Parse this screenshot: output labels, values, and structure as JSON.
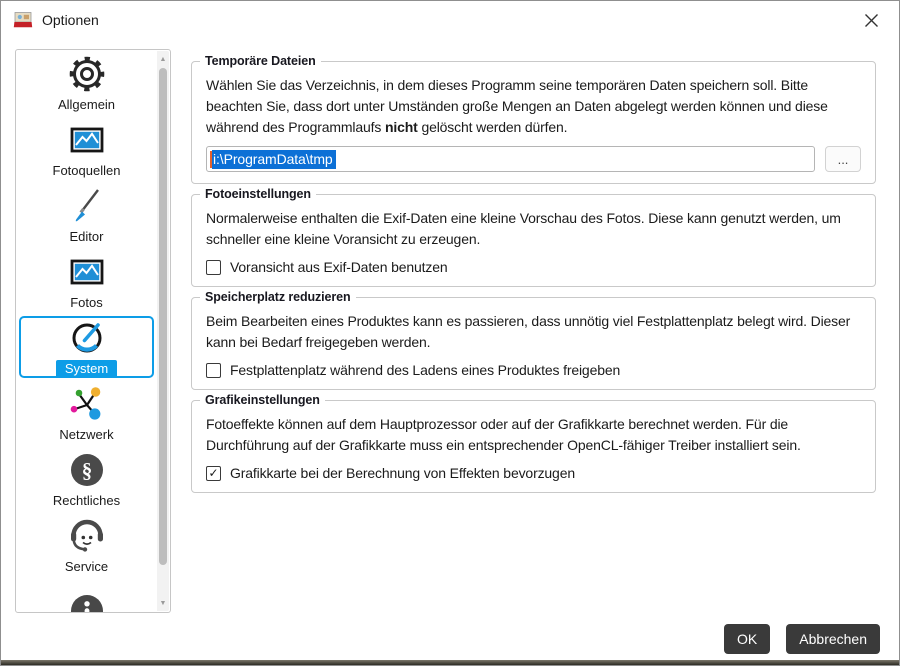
{
  "window": {
    "title": "Optionen"
  },
  "icons": {
    "checkmark": "✓",
    "scroll_up": "▲",
    "scroll_down": "▼"
  },
  "colors": {
    "accent": "#0d9de7",
    "selection": "#0c70d6",
    "button_dark": "#3a3a3a"
  },
  "sidebar": {
    "items": [
      {
        "label": "Allgemein",
        "icon": "gear",
        "selected": false
      },
      {
        "label": "Fotoquellen",
        "icon": "photo",
        "selected": false
      },
      {
        "label": "Editor",
        "icon": "brush",
        "selected": false
      },
      {
        "label": "Fotos",
        "icon": "photo",
        "selected": false
      },
      {
        "label": "System",
        "icon": "gauge",
        "selected": true
      },
      {
        "label": "Netzwerk",
        "icon": "network",
        "selected": false
      },
      {
        "label": "Rechtliches",
        "icon": "paragraph",
        "selected": false
      },
      {
        "label": "Service",
        "icon": "headset",
        "selected": false
      },
      {
        "label": "",
        "icon": "info",
        "selected": false
      }
    ]
  },
  "groups": [
    {
      "legend": "Temporäre Dateien",
      "desc_before": "Wählen Sie das Verzeichnis, in dem dieses Programm seine temporären Daten speichern soll. Bitte beachten Sie, dass dort unter Umständen große Mengen an Daten abgelegt werden können und diese während des Programmlaufs",
      "desc_bold": "nicht",
      "desc_after": "gelöscht werden dürfen.",
      "input_value": "i:\\ProgramData\\tmp",
      "browse_label": "..."
    },
    {
      "legend": "Fotoeinstellungen",
      "desc": "Normalerweise enthalten die Exif-Daten eine kleine Vorschau des Fotos. Diese kann genutzt werden, um schneller eine kleine Voransicht zu erzeugen.",
      "checkbox": {
        "label": "Voransicht aus Exif-Daten benutzen",
        "checked": false
      }
    },
    {
      "legend": "Speicherplatz reduzieren",
      "desc": "Beim Bearbeiten eines Produktes kann es passieren, dass unnötig viel Festplattenplatz belegt wird. Dieser kann bei Bedarf freigegeben werden.",
      "checkbox": {
        "label": "Festplattenplatz während des Ladens eines Produktes freigeben",
        "checked": false
      }
    },
    {
      "legend": "Grafikeinstellungen",
      "desc": "Fotoeffekte können auf dem Hauptprozessor oder auf der Grafikkarte berechnet werden. Für die Durchführung auf der Grafikkarte muss ein entsprechender OpenCL-fähiger Treiber installiert sein.",
      "checkbox": {
        "label": "Grafikkarte bei der Berechnung von Effekten bevorzugen",
        "checked": true
      }
    }
  ],
  "footer": {
    "ok_label": "OK",
    "cancel_label": "Abbrechen"
  }
}
